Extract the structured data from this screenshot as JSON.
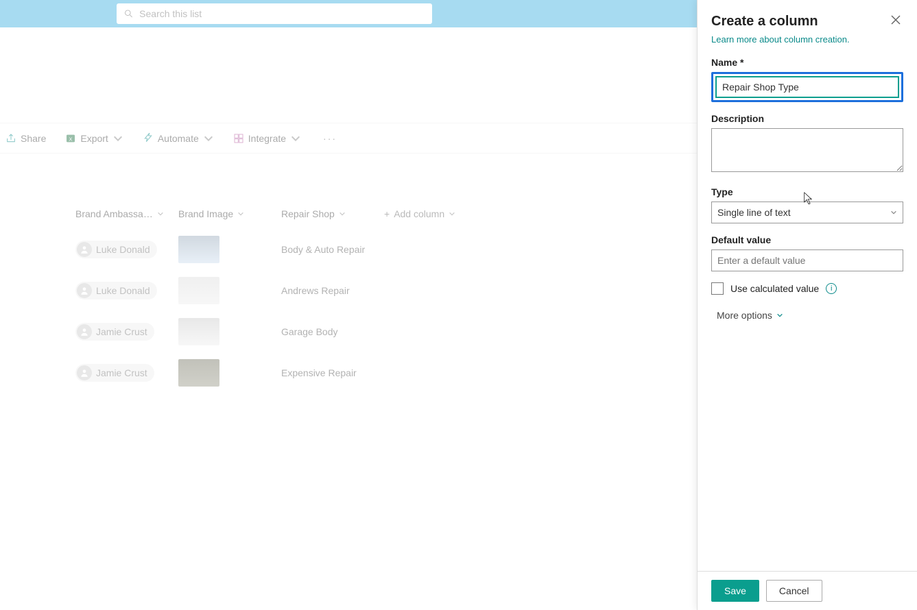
{
  "search": {
    "placeholder": "Search this list"
  },
  "commands": {
    "share": "Share",
    "export": "Export",
    "automate": "Automate",
    "integrate": "Integrate"
  },
  "columns": {
    "c1": "Brand Ambassa…",
    "c2": "Brand Image",
    "c3": "Repair Shop",
    "add": "Add column"
  },
  "rows": [
    {
      "ambassador": "Luke Donald",
      "shop": "Body & Auto Repair"
    },
    {
      "ambassador": "Luke Donald",
      "shop": "Andrews Repair"
    },
    {
      "ambassador": "Jamie Crust",
      "shop": "Garage Body"
    },
    {
      "ambassador": "Jamie Crust",
      "shop": "Expensive Repair"
    }
  ],
  "panel": {
    "title": "Create a column",
    "learn": "Learn more about column creation.",
    "nameLabel": "Name *",
    "nameValue": "Repair Shop Type",
    "descLabel": "Description",
    "typeLabel": "Type",
    "typeValue": "Single line of text",
    "defaultLabel": "Default value",
    "defaultPlaceholder": "Enter a default value",
    "calcLabel": "Use calculated value",
    "moreOptions": "More options",
    "save": "Save",
    "cancel": "Cancel"
  }
}
